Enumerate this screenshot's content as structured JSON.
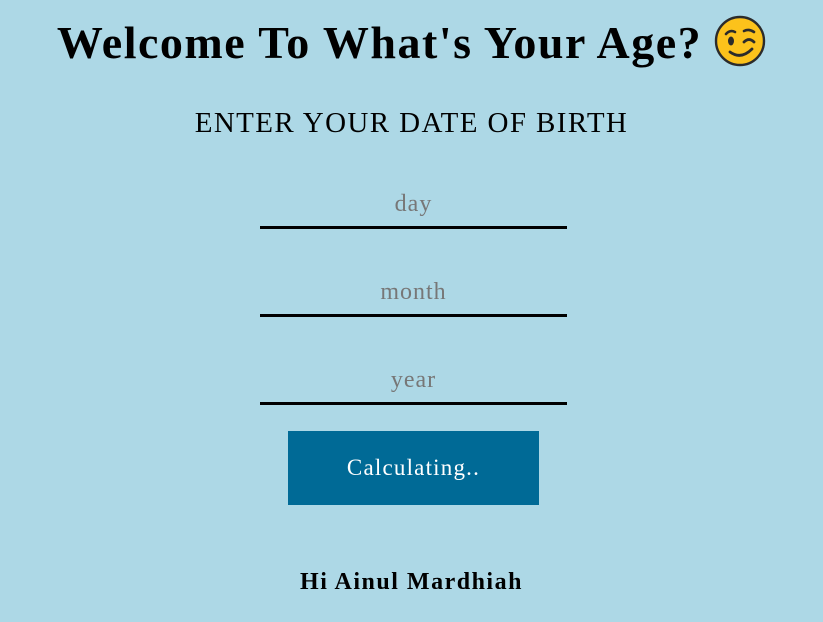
{
  "header": {
    "title": "Welcome To What's Your Age?",
    "emoji": "winking-face-icon"
  },
  "form": {
    "heading": "ENTER YOUR DATE OF BIRTH",
    "day": {
      "placeholder": "day",
      "value": ""
    },
    "month": {
      "placeholder": "month",
      "value": ""
    },
    "year": {
      "placeholder": "year",
      "value": ""
    },
    "button_label": "Calculating.."
  },
  "greeting": "Hi Ainul Mardhiah",
  "colors": {
    "background": "#add8e6",
    "button": "#006a96",
    "button_text": "#ffffff",
    "underline": "#000000",
    "placeholder": "#777777"
  }
}
